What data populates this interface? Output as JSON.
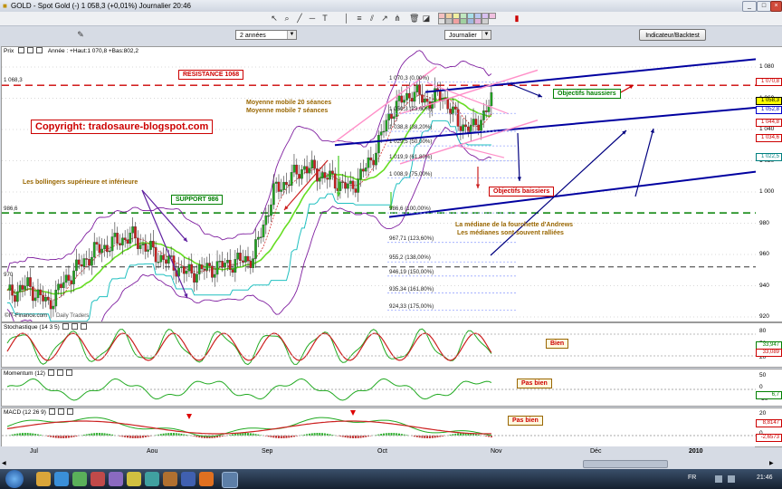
{
  "window": {
    "title": "GOLD - Spot Gold (-)   1 058,3 (+0,01%)   Journalier   20:46"
  },
  "toolbar": {
    "period_select": "2 années",
    "interval_select": "Journalier",
    "indicator_button": "Indicateur/Backtest",
    "swatch_colors": [
      "#f4c0c0",
      "#f0d0a0",
      "#f0f0a0",
      "#c0e8c0",
      "#a8e0e8",
      "#b8c8f0",
      "#d8c0f0",
      "#f0c0e0",
      "#e0e0e0",
      "#c0c0c0",
      "#f0a0a0",
      "#a0d0a0",
      "#a0b8e0",
      "#e0b0d8",
      "#d0d0d0"
    ]
  },
  "price_panel": {
    "header_prefix": "Prix",
    "header_info": "Année : +Haut:1 070,8 +Bas:802,2",
    "watermark": "©IT-Finance.com",
    "watermark2": "Daily Traders",
    "y_ticks": [
      "1 080",
      "1 060",
      "1 040",
      "1 020",
      "1 000",
      "980",
      "960",
      "940",
      "920"
    ],
    "price_tags": [
      {
        "value": "1 070,8",
        "color": "#cc0000"
      },
      {
        "value": "1 058,3",
        "color": "#000000",
        "bg": "#ffff00"
      },
      {
        "value": "1 052,8",
        "color": "#0000cc"
      },
      {
        "value": "1 044,8",
        "color": "#cc0000"
      },
      {
        "value": "1 034,6",
        "color": "#cc0000"
      },
      {
        "value": "1 022,5",
        "color": "#008080"
      }
    ],
    "left_level_a": "1 068,3",
    "left_level_b": "986,6",
    "left_level_c": "970",
    "copyright": "Copyright: tradosaure-blogspot.com",
    "resistance": "RESISTANCE 1068",
    "support": "SUPPORT 986",
    "moving_avg_1": "Moyenne mobile 20 séances",
    "moving_avg_2": "Moyenne mobile 7 séances",
    "bollinger": "Les bollingers supérieure et inférieure",
    "objectifs_haussiers": "Objectifs haussiers",
    "objectifs_baissiers": "Objectifs baissiers",
    "median_1": "La médiane de la fourchette d'Andrews",
    "median_2": "Les médianes sont souvent ralliées",
    "fib_levels": [
      "1 070,3 (0,00%)",
      "1 050,3 (23,60%)",
      "1 038,8 (38,20%)",
      "1 029,5 (50,00%)",
      "1 019,9 (61,80%)",
      "1 008,9 (75,00%)",
      "986,6 (100,00%)",
      "967,71 (123,60%)",
      "955,2 (138,00%)",
      "946,19 (150,00%)",
      "935,34 (161,80%)",
      "924,33 (175,00%)"
    ]
  },
  "stoch_panel": {
    "header": "Stochastique (14 3 5)",
    "note": "Bien",
    "y_ticks": [
      "80",
      "50",
      "20"
    ],
    "tags": [
      {
        "value": "33,947",
        "color": "#008000"
      },
      {
        "value": "33,089",
        "color": "#cc0000"
      }
    ]
  },
  "momentum_panel": {
    "header": "Momentum (12)",
    "note": "Pas bien",
    "y_ticks": [
      "50",
      "0",
      "-50"
    ],
    "tags": [
      {
        "value": "6,7",
        "color": "#008000"
      }
    ]
  },
  "macd_panel": {
    "header": "MACD (12 26 9)",
    "note": "Pas bien",
    "y_ticks": [
      "20",
      "0"
    ],
    "tags": [
      {
        "value": "8,8147",
        "color": "#cc0000"
      },
      {
        "value": "-2,6573",
        "color": "#cc0000"
      }
    ]
  },
  "x_axis": [
    "Jul",
    "Aou",
    "Sep",
    "Oct",
    "Nov",
    "Déc",
    "2010"
  ],
  "taskbar": {
    "lang": "FR",
    "clock": "21:46"
  },
  "colors": {
    "candle_up": "#1fa31f",
    "candle_down": "#c81e1e",
    "resistance": "#cc0000",
    "support": "#008000",
    "channel": "#0000a0",
    "pitchfork": "#ff8fc8"
  }
}
